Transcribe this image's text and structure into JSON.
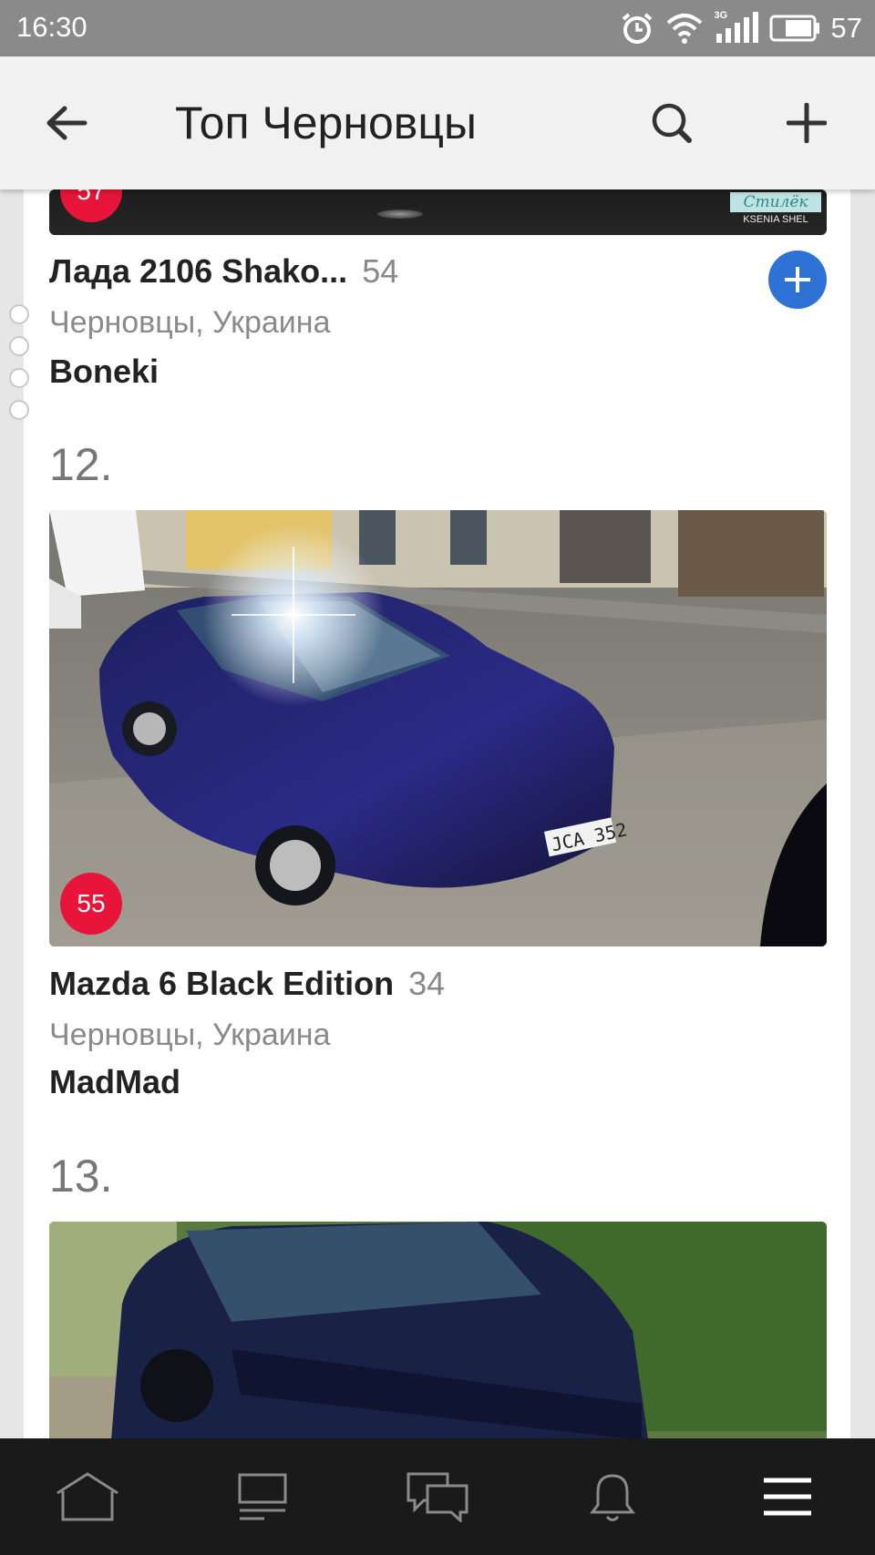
{
  "status": {
    "time": "16:30",
    "network": "3G",
    "battery": "57"
  },
  "header": {
    "title": "Топ Черновцы"
  },
  "entries": [
    {
      "badge": "57",
      "name": "Лада 2106 Shako...",
      "score": "54",
      "location": "Черновцы, Украина",
      "user": "Boneki",
      "watermark_line1": "Стилёк",
      "watermark_line2": "KSENIA SHEL"
    },
    {
      "rank": "12.",
      "badge": "55",
      "plate": "JCA 352",
      "name": "Mazda 6 Black Edition",
      "score": "34",
      "location": "Черновцы, Украина",
      "user": "MadMad"
    },
    {
      "rank": "13."
    }
  ],
  "icons": {
    "back": "arrow-left-icon",
    "search": "search-icon",
    "add": "plus-icon",
    "follow": "plus-circle-icon",
    "nav": [
      "home-icon",
      "feed-icon",
      "messages-icon",
      "notifications-icon",
      "menu-icon"
    ]
  },
  "colors": {
    "badge": "#e8143a",
    "follow": "#2f72d6",
    "status_bar": "#8a8a8a",
    "app_bar": "#f1f1f1",
    "bottom_nav": "#1a1a1a"
  }
}
